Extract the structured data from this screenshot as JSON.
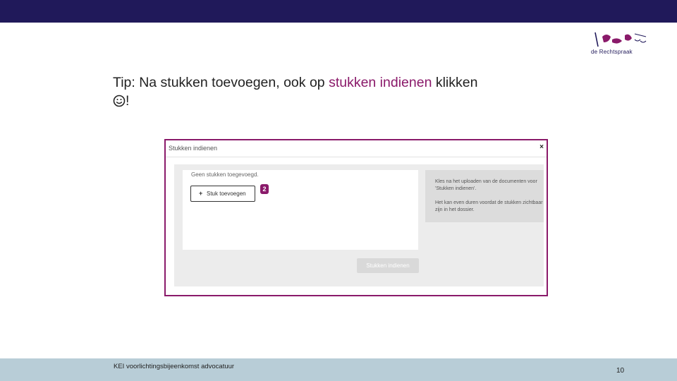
{
  "slide": {
    "title_part1": "Tip: Na stukken toevoegen, ook op ",
    "title_accent": "stukken indienen",
    "title_part2": " klikken",
    "title_end": "!",
    "footer": "KEI voorlichtingsbijeenkomst advocatuur",
    "page_number": "10"
  },
  "logo": {
    "icon": "rechtspraak-logo-icon",
    "text": "de Rechtspraak"
  },
  "dialog": {
    "title": "Stukken indienen",
    "close_glyph": "×",
    "empty_text": "Geen stukken toegevoegd.",
    "add_glyph": "+",
    "add_label": "Stuk toevoegen",
    "step_badge": "2",
    "info_line1": "Kles na het uploaden van de documenten voor 'Stukken indienen'.",
    "info_line2": "Het kan even duren voordat de stukken zichtbaar zijn in het dossier.",
    "submit_label": "Stukken indienen"
  },
  "colors": {
    "header_band": "#20195a",
    "accent": "#8a1a6a",
    "footer_band": "#b8cdd7"
  }
}
